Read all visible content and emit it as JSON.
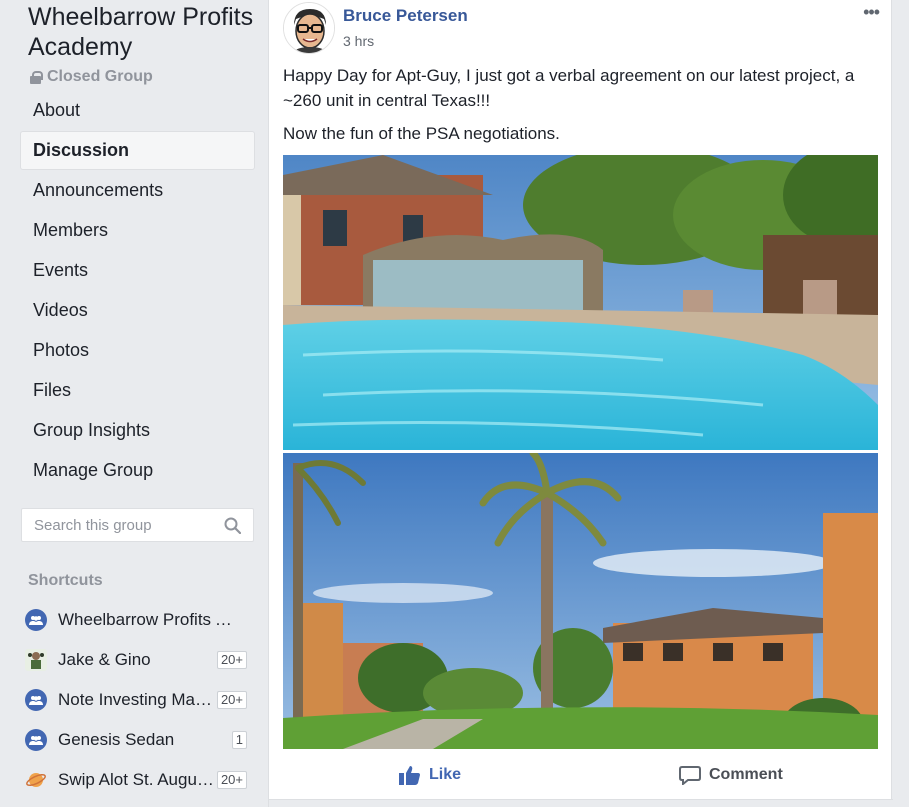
{
  "group": {
    "name": "Wheelbarrow Profits Academy",
    "privacy": "Closed Group"
  },
  "nav": {
    "items": [
      {
        "label": "About",
        "active": false
      },
      {
        "label": "Discussion",
        "active": true
      },
      {
        "label": "Announcements",
        "active": false
      },
      {
        "label": "Members",
        "active": false
      },
      {
        "label": "Events",
        "active": false
      },
      {
        "label": "Videos",
        "active": false
      },
      {
        "label": "Photos",
        "active": false
      },
      {
        "label": "Files",
        "active": false
      },
      {
        "label": "Group Insights",
        "active": false
      },
      {
        "label": "Manage Group",
        "active": false
      }
    ]
  },
  "search": {
    "placeholder": "Search this group"
  },
  "shortcuts": {
    "title": "Shortcuts",
    "items": [
      {
        "label": "Wheelbarrow Profits Academy",
        "badge": "",
        "icon": "group-icon"
      },
      {
        "label": "Jake & Gino",
        "badge": "20+",
        "icon": "jake-gino-avatar-icon"
      },
      {
        "label": "Note Investing Made Easy",
        "badge": "20+",
        "icon": "group-icon"
      },
      {
        "label": "Genesis Sedan",
        "badge": "1",
        "icon": "group-icon"
      },
      {
        "label": "Swip Alot St. Augustine",
        "badge": "20+",
        "icon": "planet-icon"
      }
    ]
  },
  "post": {
    "author": "Bruce Petersen",
    "time": "3 hrs",
    "paragraph1": "Happy Day for Apt-Guy, I just got a verbal agreement on our latest project, a ~260 unit in central Texas!!!",
    "paragraph2": "Now the fun of the PSA negotiations.",
    "more": "•••"
  },
  "actions": {
    "like": "Like",
    "comment": "Comment"
  },
  "colors": {
    "link_blue": "#385898",
    "fb_blue": "#4267b2",
    "page_bg": "#e9ebee",
    "muted": "#90949c"
  }
}
